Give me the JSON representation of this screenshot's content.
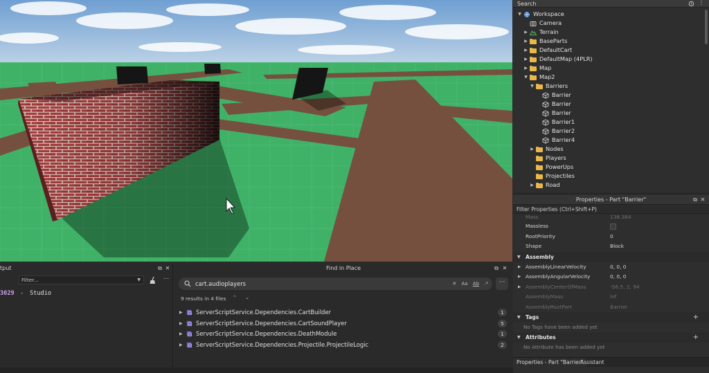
{
  "explorer": {
    "search_label": "Search",
    "items": [
      {
        "label": "Workspace",
        "depth": 0,
        "expanded": true,
        "icon": "workspace-icon"
      },
      {
        "label": "Camera",
        "depth": 1,
        "expanded": null,
        "icon": "camera-icon"
      },
      {
        "label": "Terrain",
        "depth": 1,
        "expanded": false,
        "icon": "terrain-icon"
      },
      {
        "label": "BaseParts",
        "depth": 1,
        "expanded": false,
        "icon": "folder-icon"
      },
      {
        "label": "DefaultCart",
        "depth": 1,
        "expanded": false,
        "icon": "folder-icon"
      },
      {
        "label": "DefaultMap (4PLR)",
        "depth": 1,
        "expanded": false,
        "icon": "folder-icon"
      },
      {
        "label": "Map",
        "depth": 1,
        "expanded": false,
        "icon": "folder-icon"
      },
      {
        "label": "Map2",
        "depth": 1,
        "expanded": true,
        "icon": "folder-icon"
      },
      {
        "label": "Barriers",
        "depth": 2,
        "expanded": true,
        "icon": "folder-icon"
      },
      {
        "label": "Barrier",
        "depth": 3,
        "expanded": null,
        "icon": "part-icon"
      },
      {
        "label": "Barrier",
        "depth": 3,
        "expanded": null,
        "icon": "part-icon"
      },
      {
        "label": "Barrier",
        "depth": 3,
        "expanded": null,
        "icon": "part-icon"
      },
      {
        "label": "Barrier1",
        "depth": 3,
        "expanded": null,
        "icon": "part-icon"
      },
      {
        "label": "Barrier2",
        "depth": 3,
        "expanded": null,
        "icon": "part-icon"
      },
      {
        "label": "Barrier4",
        "depth": 3,
        "expanded": null,
        "icon": "part-icon"
      },
      {
        "label": "Nodes",
        "depth": 2,
        "expanded": false,
        "icon": "folder-icon"
      },
      {
        "label": "Players",
        "depth": 2,
        "expanded": null,
        "icon": "folder-icon"
      },
      {
        "label": "PowerUps",
        "depth": 2,
        "expanded": null,
        "icon": "folder-icon"
      },
      {
        "label": "Projectiles",
        "depth": 2,
        "expanded": null,
        "icon": "folder-icon"
      },
      {
        "label": "Road",
        "depth": 2,
        "expanded": false,
        "icon": "folder-icon"
      }
    ]
  },
  "properties": {
    "title": "Properties - Part \"Barrier\"",
    "filter_placeholder": "Filter Properties (Ctrl+Shift+P)",
    "rows_top": [
      {
        "name": "Mass",
        "value": "138.384",
        "dim": true
      },
      {
        "name": "Massless",
        "value": "",
        "checkbox": true
      },
      {
        "name": "RootPriority",
        "value": "0"
      },
      {
        "name": "Shape",
        "value": "Block"
      }
    ],
    "assembly_label": "Assembly",
    "assembly_rows": [
      {
        "name": "AssemblyLinearVelocity",
        "value": "0, 0, 0",
        "expandable": true
      },
      {
        "name": "AssemblyAngularVelocity",
        "value": "0, 0, 0",
        "expandable": true
      },
      {
        "name": "AssemblyCenterOfMass",
        "value": "-56.5, 2, 94",
        "expandable": true,
        "dim": true
      },
      {
        "name": "AssemblyMass",
        "value": "inf",
        "dim": true
      },
      {
        "name": "AssemblyRootPart",
        "value": "Barrier",
        "dim": true
      }
    ],
    "tags_label": "Tags",
    "tags_empty": "No Tags have been added yet",
    "attributes_label": "Attributes",
    "attributes_empty": "No Attribute has been added yet",
    "tabs": [
      "Properties - Part \"Barrier\"",
      "Assistant"
    ]
  },
  "output": {
    "title": "tput",
    "filter_label": "Filter...",
    "line_id": "3029",
    "line_sep": "-",
    "line_text": "Studio"
  },
  "find": {
    "title": "Find in Place",
    "query": "cart.audioplayers",
    "option_case": "Aa",
    "option_word": "Ab",
    "option_regex": ".*",
    "summary": "9 results in 4 files",
    "results": [
      {
        "path": "ServerScriptService.Dependencies.CartBuilder",
        "count": "1"
      },
      {
        "path": "ServerScriptService.Dependencies.CartSoundPlayer",
        "count": "5"
      },
      {
        "path": "ServerScriptService.Dependencies.DeathModule",
        "count": "1"
      },
      {
        "path": "ServerScriptService.Dependencies.Projectile.ProjectileLogic",
        "count": "2"
      }
    ]
  },
  "colors": {
    "folder": "#e8b84a",
    "script": "#7b68c8",
    "terrain": "#5cb85c",
    "grass": "#3fb268",
    "road": "#7a4f40",
    "brick": "#a03a3a"
  }
}
